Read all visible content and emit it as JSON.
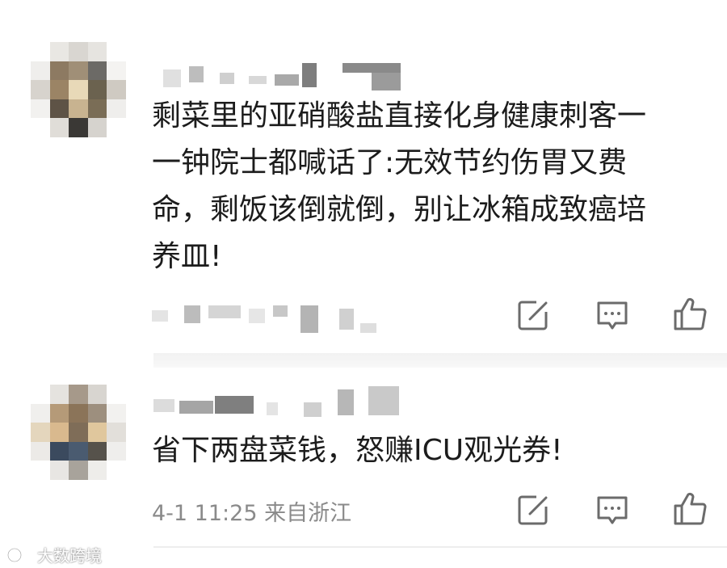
{
  "comments": [
    {
      "username": "",
      "text": "剩菜里的亚硝酸盐直接化身健康刺客一\n一钟院士都喊话了:无效节约伤胃又费\n命，剩饭该倒就倒，别让冰箱成致癌培\n养皿!",
      "meta": ""
    },
    {
      "username": "",
      "text": "省下两盘菜钱，怒赚ICU观光券!",
      "meta": "4-1 11:25  来自浙江"
    }
  ],
  "actions": {
    "repost_icon": "edit-square-icon",
    "comment_icon": "comment-bubble-icon",
    "like_icon": "thumbs-up-icon"
  },
  "watermark": {
    "text": "大数跨境",
    "logo_icon": "brand-logo-icon"
  },
  "colors": {
    "text": "#1c1c1c",
    "meta": "#8a8a8a",
    "icon": "#6b6b6b",
    "divider": "#f2f2f2"
  }
}
